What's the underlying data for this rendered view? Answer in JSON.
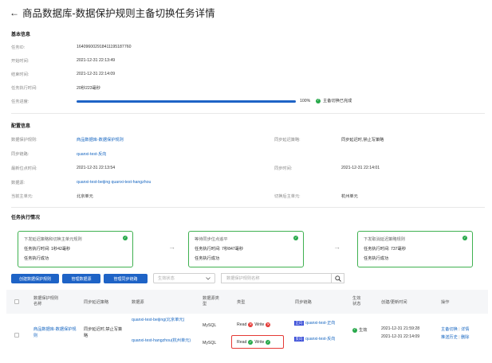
{
  "header": {
    "back_glyph": "←",
    "title": "商品数据库-数据保护规则主备切换任务详情"
  },
  "basic": {
    "title": "基本信息",
    "rows": [
      {
        "label": "任务ID:",
        "value": "164096002918411195187760"
      },
      {
        "label": "开始时间:",
        "value": "2021-12-31 22:13:49"
      },
      {
        "label": "结束时间:",
        "value": "2021-12-31 22:14:09"
      },
      {
        "label": "任务执行时间:",
        "value": "20秒223毫秒"
      }
    ],
    "progress": {
      "label": "任务进度:",
      "percent": 100,
      "percent_text": "100%",
      "status": "主备切换已完成"
    }
  },
  "config": {
    "title": "配置信息",
    "left": [
      {
        "label": "数据保护规则:",
        "value": "商品数据库-数据保护规则",
        "link": true
      },
      {
        "label": "同步链路:",
        "value": "quanxi-test-反向",
        "link": true
      },
      {
        "label": "最新位点时间:",
        "value": "2021-12-31 22:13:54",
        "link": false
      },
      {
        "label": "数据源:",
        "value": "quanxi-test-beijing  quanxi-test-hangzhou",
        "link": true
      },
      {
        "label": "当前主单元:",
        "value": "北京单元",
        "link": false
      }
    ],
    "right": [
      {
        "label": "同步延迟策略:",
        "value": "同步延迟时,禁止写策略"
      },
      {
        "label": "同步时间:",
        "value": "2021-12-31 22:14:01"
      },
      {
        "label": "切换后主单元:",
        "value": "杭州单元"
      }
    ]
  },
  "execution": {
    "title": "任务执行情况",
    "cards": [
      {
        "head": "下发延迟策略和切换主单元规则",
        "time": "任务执行时间: 1秒42毫秒",
        "status": "任务执行成功"
      },
      {
        "head": "等待同步位点追平",
        "time": "任务执行时间: 7秒847毫秒",
        "status": "任务执行成功"
      },
      {
        "head": "下发取消延迟策略规则",
        "time": "任务执行时间: 737毫秒",
        "status": "任务执行成功"
      }
    ]
  },
  "toolbar": {
    "create_label": "创建数据保护规则",
    "manage_ds_label": "管理数据源",
    "manage_sync_label": "管理同步链路",
    "status_placeholder": "生效状态",
    "search_placeholder": "数据保护规则名称"
  },
  "table": {
    "headers": [
      "数据保护规则名称",
      "同步延迟策略",
      "数据源",
      "数据源类型",
      "类型",
      "同步链路",
      "生效状态",
      "创建/更新时间",
      "操作"
    ],
    "row": {
      "name": "商品数据库-数据保护规则",
      "strategy": "同步延迟时,禁止写策略",
      "sources": [
        {
          "name": "quanxi-test-beijing(北京单元)",
          "type": "MySQL",
          "read": "Read",
          "write": "Write",
          "ok": false
        },
        {
          "name": "quanxi-test-hangzhou(杭州单元)",
          "type": "MySQL",
          "read": "Read",
          "write": "Write",
          "ok": true
        }
      ],
      "links": [
        {
          "tag": "正向",
          "name": "quanxi-test-正向"
        },
        {
          "tag": "反向",
          "name": "quanxi-test-反向"
        }
      ],
      "status": "生效",
      "times": [
        "2021-12-31 21:59:28",
        "2021-12-31 22:14:09"
      ],
      "ops": [
        [
          "主备切换",
          "详情"
        ],
        [
          "推送历史",
          "删除"
        ]
      ]
    }
  }
}
